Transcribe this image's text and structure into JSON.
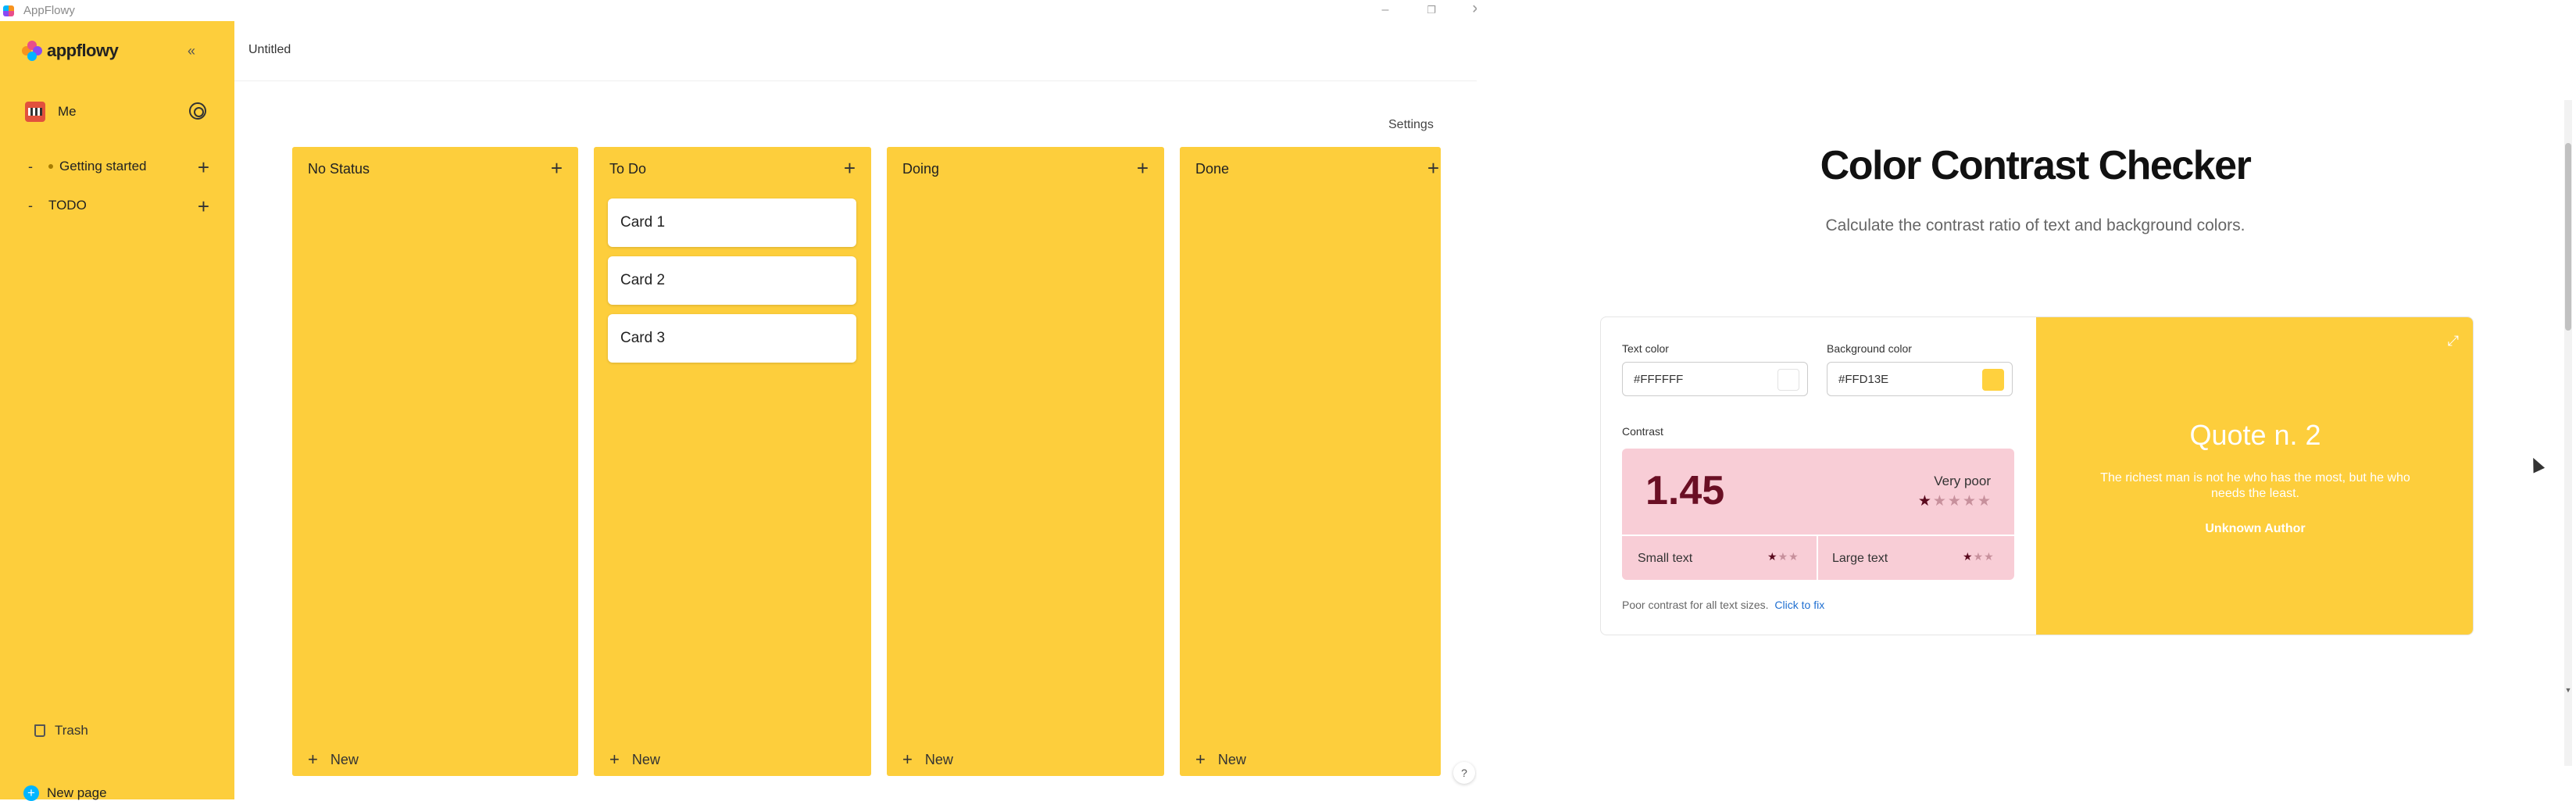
{
  "window": {
    "title": "AppFlowy"
  },
  "sidebar": {
    "brand": "appflowy",
    "user": {
      "name": "Me"
    },
    "items": [
      {
        "label": "Getting started"
      },
      {
        "label": "TODO"
      }
    ],
    "trash_label": "Trash",
    "new_page_label": "New page"
  },
  "main": {
    "doc_title": "Untitled",
    "settings_label": "Settings",
    "columns": [
      {
        "title": "No Status",
        "cards": [],
        "new_label": "New"
      },
      {
        "title": "To Do",
        "cards": [
          "Card 1",
          "Card 2",
          "Card 3"
        ],
        "new_label": "New"
      },
      {
        "title": "Doing",
        "cards": [],
        "new_label": "New"
      },
      {
        "title": "Done",
        "cards": [],
        "new_label": "New"
      }
    ],
    "help_label": "?"
  },
  "checker": {
    "title": "Color Contrast Checker",
    "subtitle": "Calculate the contrast ratio of text and background colors.",
    "text_color_label": "Text color",
    "text_color_value": "#FFFFFF",
    "background_color_label": "Background color",
    "background_color_value": "#FFD13E",
    "contrast_label": "Contrast",
    "ratio": "1.45",
    "rating": "Very poor",
    "rating_stars": 1,
    "small_text_label": "Small text",
    "small_text_stars": 1,
    "large_text_label": "Large text",
    "large_text_stars": 1,
    "note": "Poor contrast for all text sizes.",
    "fix_link": "Click to fix",
    "preview": {
      "title": "Quote n. 2",
      "text": "The richest man is not he who has the most, but he who needs the least.",
      "author": "Unknown Author"
    }
  },
  "colors": {
    "accent_yellow": "#fdce3c",
    "contrast_bg": "#f8cdd6",
    "ratio_text": "#6a0f24",
    "link": "#1f6fd1"
  }
}
